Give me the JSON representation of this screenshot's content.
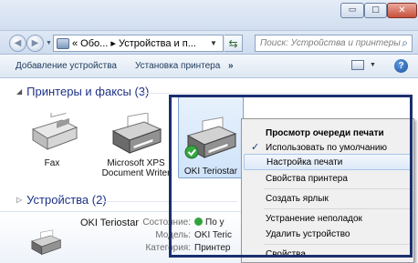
{
  "window": {
    "minimize_glyph": "▭",
    "maximize_glyph": "□",
    "close_glyph": "✕"
  },
  "address": {
    "path_text": "« Обо... ▸ Устройства и п...",
    "search_placeholder": "Поиск: Устройства и принтеры"
  },
  "toolbar": {
    "add_device": "Добавление устройства",
    "add_printer": "Установка принтера",
    "more": "»",
    "help": "?"
  },
  "groups": {
    "printers": "Принтеры и факсы (3)",
    "devices": "Устройства (2)"
  },
  "devices": [
    {
      "name": "Fax"
    },
    {
      "name_line1": "Microsoft XPS",
      "name_line2": "Document Writer"
    },
    {
      "name": "OKI Teriostar"
    }
  ],
  "context_menu": {
    "items": [
      {
        "label": "Просмотр очереди печати",
        "bold": true
      },
      {
        "label": "Использовать по умолчанию",
        "checked": true
      },
      {
        "label": "Настройка печати",
        "highlighted": true
      },
      {
        "label": "Свойства принтера"
      },
      {
        "label": "Создать ярлык"
      },
      {
        "label": "Устранение неполадок"
      },
      {
        "label": "Удалить устройство"
      },
      {
        "label": "Свойства"
      }
    ]
  },
  "details": {
    "name": "OKI Teriostar",
    "status_key": "Состояние:",
    "status_val": "По у",
    "model_key": "Модель:",
    "model_val": "OKI Teric",
    "category_key": "Категория:",
    "category_val": "Принтер"
  },
  "colors": {
    "accent": "#1e3287",
    "selection_frame": "#1a2f6e",
    "status_ok": "#31a43c"
  }
}
